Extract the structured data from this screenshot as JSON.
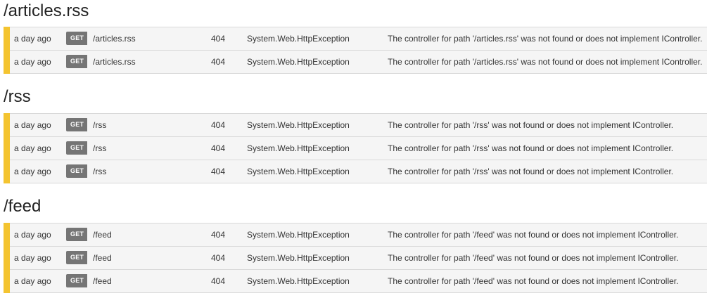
{
  "accent_color": "#f4c430",
  "badge_color": "#757575",
  "groups": [
    {
      "title": "/articles.rss",
      "rows": [
        {
          "time": "a day ago",
          "method": "GET",
          "path": "/articles.rss",
          "status": "404",
          "exception": "System.Web.HttpException",
          "message": "The controller for path '/articles.rss' was not found or does not implement IController."
        },
        {
          "time": "a day ago",
          "method": "GET",
          "path": "/articles.rss",
          "status": "404",
          "exception": "System.Web.HttpException",
          "message": "The controller for path '/articles.rss' was not found or does not implement IController."
        }
      ]
    },
    {
      "title": "/rss",
      "rows": [
        {
          "time": "a day ago",
          "method": "GET",
          "path": "/rss",
          "status": "404",
          "exception": "System.Web.HttpException",
          "message": "The controller for path '/rss' was not found or does not implement IController."
        },
        {
          "time": "a day ago",
          "method": "GET",
          "path": "/rss",
          "status": "404",
          "exception": "System.Web.HttpException",
          "message": "The controller for path '/rss' was not found or does not implement IController."
        },
        {
          "time": "a day ago",
          "method": "GET",
          "path": "/rss",
          "status": "404",
          "exception": "System.Web.HttpException",
          "message": "The controller for path '/rss' was not found or does not implement IController."
        }
      ]
    },
    {
      "title": "/feed",
      "rows": [
        {
          "time": "a day ago",
          "method": "GET",
          "path": "/feed",
          "status": "404",
          "exception": "System.Web.HttpException",
          "message": "The controller for path '/feed' was not found or does not implement IController."
        },
        {
          "time": "a day ago",
          "method": "GET",
          "path": "/feed",
          "status": "404",
          "exception": "System.Web.HttpException",
          "message": "The controller for path '/feed' was not found or does not implement IController."
        },
        {
          "time": "a day ago",
          "method": "GET",
          "path": "/feed",
          "status": "404",
          "exception": "System.Web.HttpException",
          "message": "The controller for path '/feed' was not found or does not implement IController."
        }
      ]
    }
  ]
}
